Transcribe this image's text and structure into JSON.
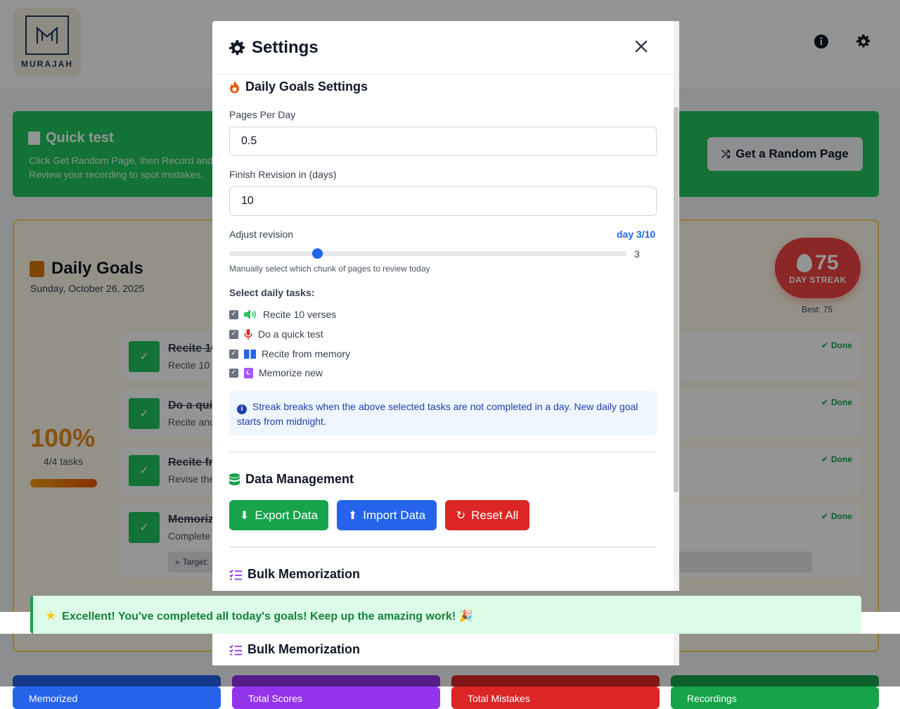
{
  "app": {
    "logo_text": "MURAJAH"
  },
  "quick_test": {
    "title": "Quick test",
    "description": "Click Get Random Page, then Record and Review your recording to spot mistakes.",
    "random_button": "Get a Random Page"
  },
  "daily_goals": {
    "title": "Daily Goals",
    "date": "Sunday, October 26, 2025",
    "percent": "100%",
    "tasks_count": "4/4 tasks",
    "streak_number": "75",
    "streak_label": "DAY STREAK",
    "streak_best": "Best: 75",
    "tasks": [
      {
        "name": "Recite 10",
        "sub": "Recite 10 ",
        "status": "Done"
      },
      {
        "name": "Do a quic",
        "sub": "Recite and",
        "status": "Done"
      },
      {
        "name": "Recite fr",
        "sub": "Revise the",
        "status": "Done"
      },
      {
        "name": "Memoriz",
        "sub": "Complete",
        "status": "Done",
        "target": "Target:"
      }
    ]
  },
  "banner": {
    "text": "Excellent! You've completed all today's goals! Keep up the amazing work! 🎉"
  },
  "stats": [
    {
      "label": "Memorized",
      "color": "#2563eb"
    },
    {
      "label": "Total Scores",
      "color": "#9333ea"
    },
    {
      "label": "Total Mistakes",
      "color": "#dc2626"
    },
    {
      "label": "Recordings",
      "color": "#16a34a"
    }
  ],
  "settings": {
    "title": "Settings",
    "daily_goals_title": "Daily Goals Settings",
    "pages_per_day_label": "Pages Per Day",
    "pages_per_day_value": "0.5",
    "finish_label": "Finish Revision in (days)",
    "finish_value": "10",
    "adjust_label": "Adjust revision",
    "adjust_day": "day 3/10",
    "slider_value": "3",
    "slider_fraction": 0.222,
    "slider_hint": "Manually select which chunk of pages to review today",
    "select_tasks_label": "Select daily tasks:",
    "task_options": [
      {
        "label": "Recite 10 verses",
        "icon": "speaker-icon",
        "checked": true
      },
      {
        "label": "Do a quick test",
        "icon": "microphone-icon",
        "checked": true
      },
      {
        "label": "Recite from memory",
        "icon": "book-icon",
        "checked": true
      },
      {
        "label": "Memorize new",
        "icon": "quran-icon",
        "checked": true
      }
    ],
    "info_text": "Streak breaks when the above selected tasks are not completed in a day. New daily goal starts from midnight.",
    "data_management_title": "Data Management",
    "export_label": "Export Data",
    "import_label": "Import Data",
    "reset_label": "Reset All",
    "bulk_title": "Bulk Memorization"
  },
  "colors": {
    "green": "#16a34a",
    "blue": "#2563eb",
    "red": "#dc2626",
    "purple": "#9333ea",
    "orange": "#ea580c"
  }
}
